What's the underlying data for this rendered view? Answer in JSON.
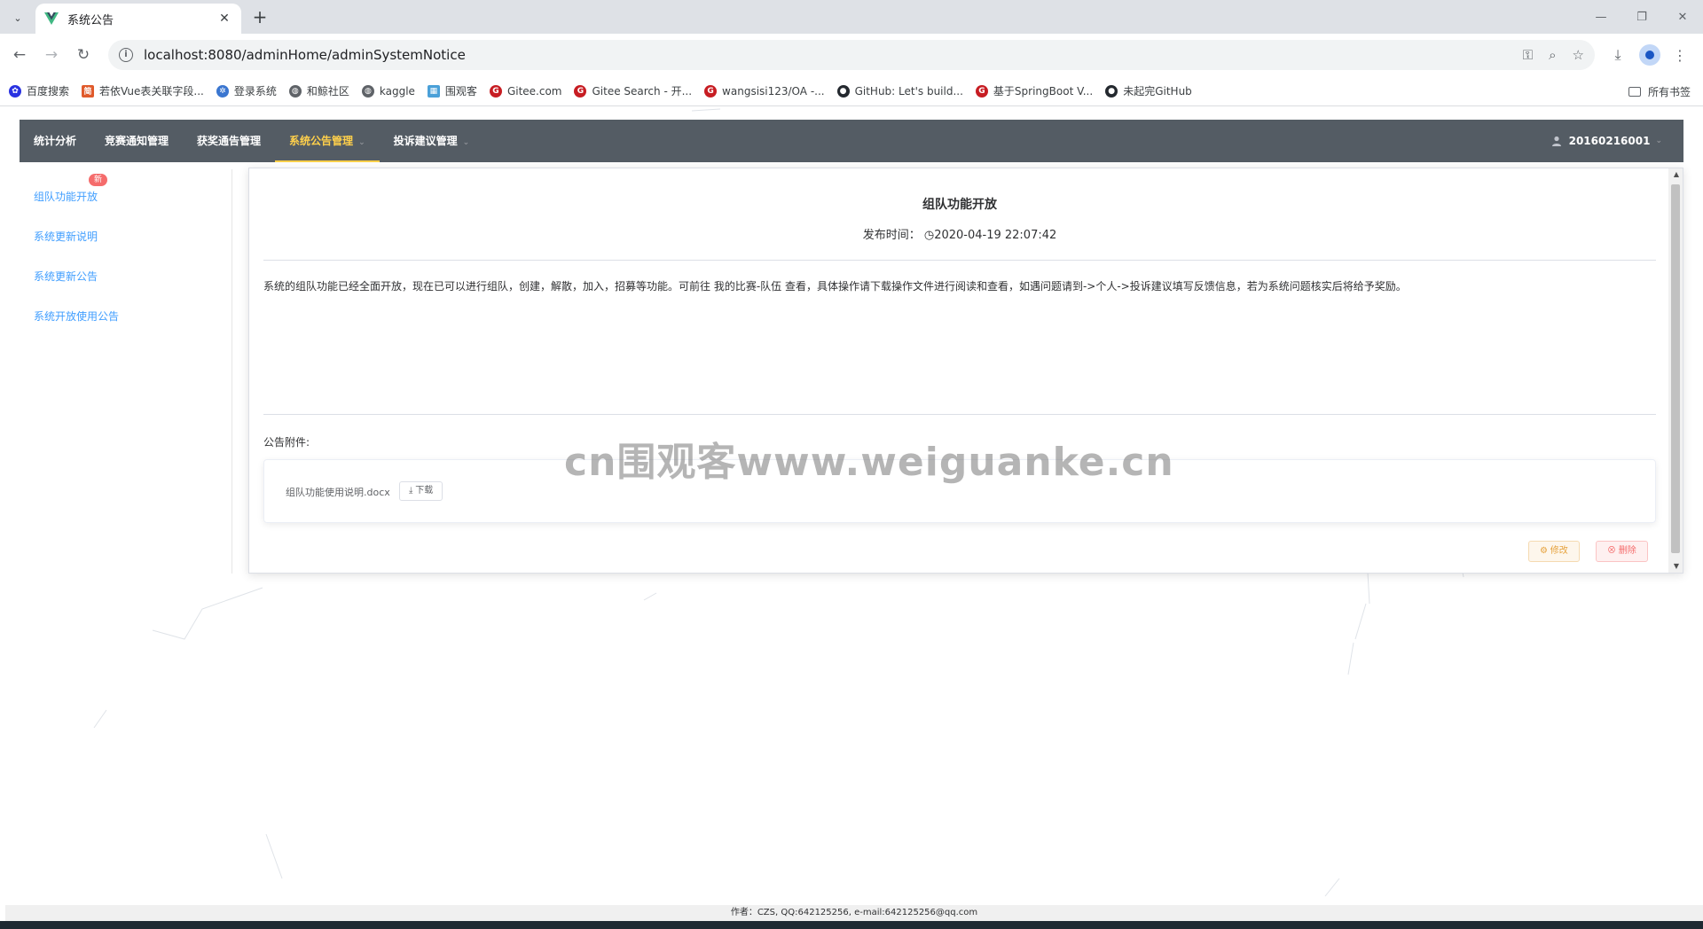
{
  "browser": {
    "tab_title": "系统公告",
    "url": "localhost:8080/adminHome/adminSystemNotice",
    "bookmarks": [
      {
        "label": "百度搜索",
        "color": "#2932e1",
        "glyph": "✿"
      },
      {
        "label": "若依Vue表关联字段...",
        "color": "#e05a2b",
        "glyph": "简"
      },
      {
        "label": "登录系统",
        "color": "#3a76d0",
        "glyph": "✲"
      },
      {
        "label": "和鲸社区",
        "color": "#5f6368",
        "glyph": "◍"
      },
      {
        "label": "kaggle",
        "color": "#5f6368",
        "glyph": "◍"
      },
      {
        "label": "围观客",
        "color": "#4aa0d8",
        "glyph": "▦"
      },
      {
        "label": "Gitee.com",
        "color": "#c71d23",
        "glyph": "G"
      },
      {
        "label": "Gitee Search - 开...",
        "color": "#c71d23",
        "glyph": "G"
      },
      {
        "label": "wangsisi123/OA -...",
        "color": "#c71d23",
        "glyph": "G"
      },
      {
        "label": "GitHub: Let's build...",
        "color": "#24292f",
        "glyph": "●"
      },
      {
        "label": "基于SpringBoot V...",
        "color": "#c71d23",
        "glyph": "G"
      },
      {
        "label": "未起完GitHub",
        "color": "#24292f",
        "glyph": "●"
      }
    ],
    "all_bookmarks": "所有书签"
  },
  "nav": {
    "items": [
      {
        "label": "统计分析",
        "has_arrow": false
      },
      {
        "label": "竞赛通知管理",
        "has_arrow": false
      },
      {
        "label": "获奖通告管理",
        "has_arrow": false
      },
      {
        "label": "系统公告管理",
        "has_arrow": true,
        "active": true
      },
      {
        "label": "投诉建议管理",
        "has_arrow": true
      }
    ],
    "user": "20160216001"
  },
  "sidebar": {
    "badge": "新",
    "items": [
      {
        "label": "组队功能开放"
      },
      {
        "label": "系统更新说明"
      },
      {
        "label": "系统更新公告"
      },
      {
        "label": "系统开放使用公告"
      }
    ]
  },
  "notice": {
    "title": "组队功能开放",
    "time_label": "发布时间：",
    "time_value": "2020-04-19 22:07:42",
    "body": "系统的组队功能已经全面开放，现在已可以进行组队，创建，解散，加入，招募等功能。可前往 我的比赛-队伍 查看，具体操作请下载操作文件进行阅读和查看，如遇问题请到->个人->投诉建议填写反馈信息，若为系统问题核实后将给予奖励。",
    "attach_label": "公告附件:",
    "file_name": "组队功能使用说明.docx",
    "download_label": "下载",
    "edit_label": "修改",
    "delete_label": "删除"
  },
  "watermark": "cn围观客www.weiguanke.cn",
  "footer": "作者：CZS, QQ:642125256, e-mail:642125256@qq.com",
  "colors": {
    "nav_bg": "#545c64",
    "nav_active": "#ffd04b",
    "link": "#409eff",
    "warning": "#e6a23c",
    "danger": "#f56c6c"
  }
}
